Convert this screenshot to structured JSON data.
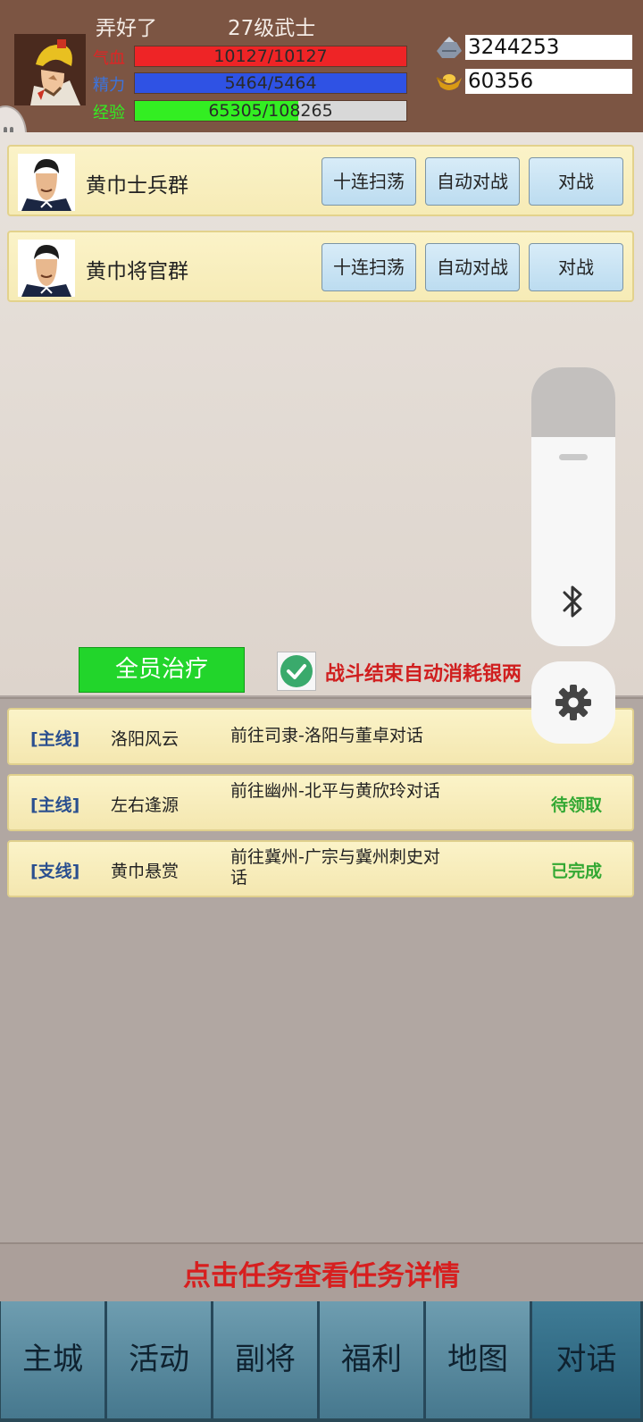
{
  "player": {
    "name": "弄好了",
    "level_title": "27级武士",
    "hp": {
      "label": "气血",
      "text": "10127/10127",
      "fraction": 1.0
    },
    "mp": {
      "label": "精力",
      "text": "5464/5464",
      "fraction": 1.0
    },
    "exp": {
      "label": "经验",
      "text": "65305/108265",
      "fraction": 0.603
    }
  },
  "resources": {
    "silver": "3244253",
    "gold": "60356"
  },
  "enemies": [
    {
      "name": "黄巾士兵群",
      "sweep_label": "十连扫荡",
      "auto_label": "自动对战",
      "battle_label": "对战"
    },
    {
      "name": "黄巾将官群",
      "sweep_label": "十连扫荡",
      "auto_label": "自动对战",
      "battle_label": "对战"
    }
  ],
  "heal_all_label": "全员治疗",
  "auto_consume_label": "战斗结束自动消耗银两",
  "quests": [
    {
      "type": "[主线]",
      "name": "洛阳风云",
      "desc": "前往司隶-洛阳与董卓对话",
      "status": ""
    },
    {
      "type": "[主线]",
      "name": "左右逢源",
      "desc": "前往幽州-北平与黄欣玲对话",
      "status": "待领取"
    },
    {
      "type": "[支线]",
      "name": "黄巾悬赏",
      "desc": "前往冀州-广宗与冀州刺史对话",
      "status": "已完成"
    }
  ],
  "hint": "点击任务查看任务详情",
  "nav": [
    "主城",
    "活动",
    "副将",
    "福利",
    "地图",
    "对话"
  ],
  "colors": {
    "hp_bar": "#ee2426",
    "mp_bar": "#2f52e4",
    "exp_bar": "#33ee22",
    "status_green": "#33a833",
    "hint_red": "#d71f1f"
  }
}
